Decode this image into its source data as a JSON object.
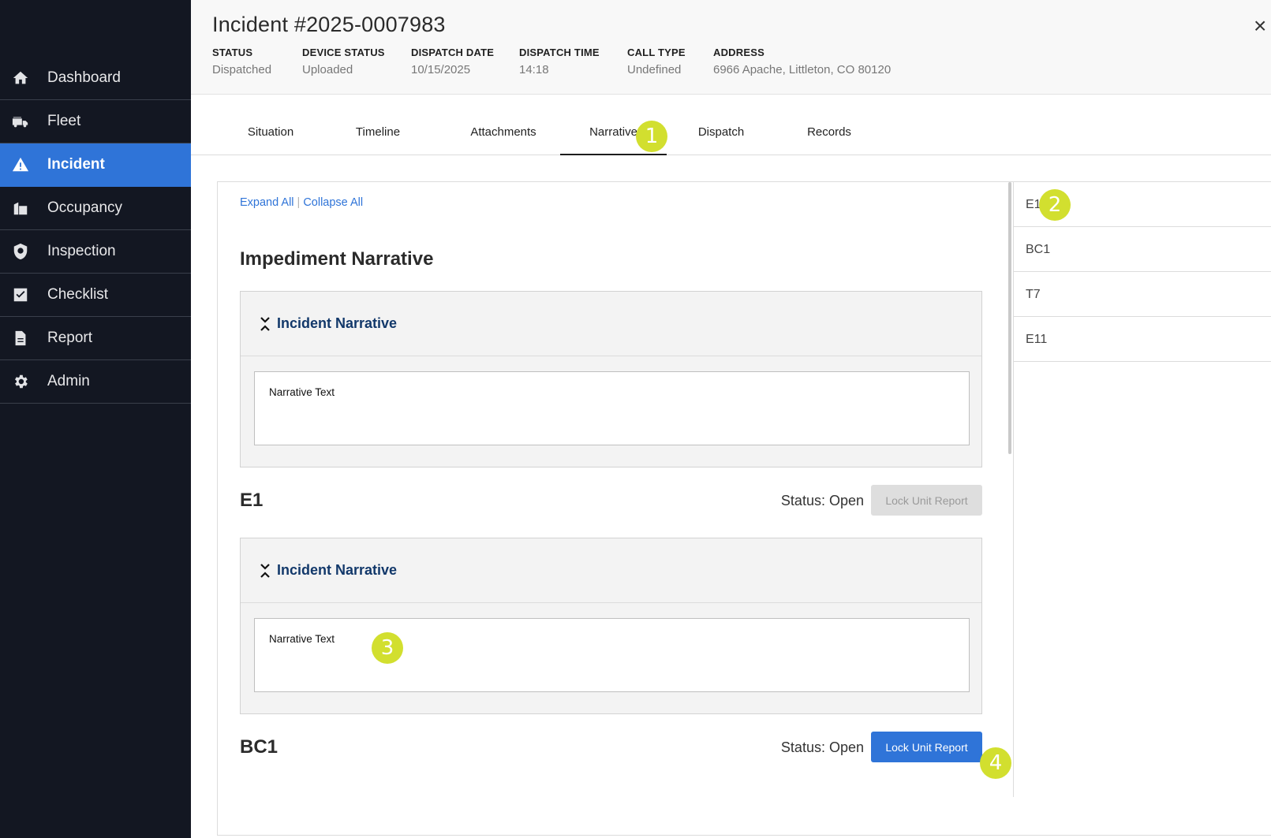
{
  "sidebar": {
    "items": [
      {
        "label": "Dashboard",
        "icon": "home-icon"
      },
      {
        "label": "Fleet",
        "icon": "fire-truck-icon"
      },
      {
        "label": "Incident",
        "icon": "warning-icon",
        "active": true
      },
      {
        "label": "Occupancy",
        "icon": "building-icon"
      },
      {
        "label": "Inspection",
        "icon": "shield-search-icon"
      },
      {
        "label": "Checklist",
        "icon": "checkbox-icon"
      },
      {
        "label": "Report",
        "icon": "document-icon"
      },
      {
        "label": "Admin",
        "icon": "gear-icon"
      }
    ]
  },
  "header": {
    "title": "Incident #2025-0007983",
    "close_label": "×",
    "fields": [
      {
        "label": "STATUS",
        "value": "Dispatched"
      },
      {
        "label": "DEVICE STATUS",
        "value": "Uploaded"
      },
      {
        "label": "DISPATCH DATE",
        "value": "10/15/2025"
      },
      {
        "label": "DISPATCH TIME",
        "value": "14:18"
      },
      {
        "label": "CALL TYPE",
        "value": "Undefined"
      },
      {
        "label": "ADDRESS",
        "value": "6966 Apache, Littleton, CO 80120"
      }
    ]
  },
  "tabs": [
    "Situation",
    "Timeline",
    "Attachments",
    "Narrative",
    "Dispatch",
    "Records"
  ],
  "active_tab": "Narrative",
  "content": {
    "expand_all": "Expand All",
    "separator": "|",
    "collapse_all": "Collapse All",
    "section_title": "Impediment Narrative",
    "incident_panel": {
      "title": "Incident Narrative",
      "text": "Narrative Text"
    },
    "units": [
      {
        "name": "E1",
        "status": "Status: Open",
        "button": "Lock Unit Report",
        "button_enabled": false,
        "panel": {
          "title": "Incident Narrative",
          "text": "Narrative Text"
        }
      },
      {
        "name": "BC1",
        "status": "Status: Open",
        "button": "Lock Unit Report",
        "button_enabled": true
      }
    ]
  },
  "unit_list": [
    "E1",
    "BC1",
    "T7",
    "E11"
  ],
  "callouts": [
    "1",
    "2",
    "3",
    "4"
  ],
  "colors": {
    "sidebar_bg": "#131722",
    "accent": "#2f74d8",
    "callout": "#d2df2f",
    "panel_title": "#12386a"
  }
}
